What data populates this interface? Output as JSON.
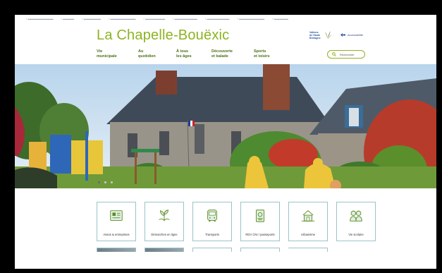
{
  "site": {
    "title": "La Chapelle-Bouëxic",
    "logo_text_lines": [
      "Vallons",
      "de Haute",
      "Bretagne"
    ],
    "accessibility_label": "Accessibilité"
  },
  "nav": {
    "items": [
      {
        "line1": "Vie",
        "line2": "municipale"
      },
      {
        "line1": "Au",
        "line2": "quotidien"
      },
      {
        "line1": "À tous",
        "line2": "les âges"
      },
      {
        "line1": "Découverte",
        "line2": "et balade"
      },
      {
        "line1": "Sports",
        "line2": "et loisirs"
      }
    ]
  },
  "search": {
    "label": "Rechercher"
  },
  "carousel": {
    "slide_count": 3,
    "active_index": 0
  },
  "quick_links": [
    {
      "label": "Assos & entreprises",
      "icon": "building-card-icon"
    },
    {
      "label": "Démarches en ligne",
      "icon": "hand-plant-icon"
    },
    {
      "label": "Transports",
      "icon": "bus-icon"
    },
    {
      "label": "RDV CNI / passeports",
      "icon": "id-document-icon"
    },
    {
      "label": "Urbanisme",
      "icon": "house-plan-icon"
    },
    {
      "label": "Vie scolaire",
      "icon": "students-icon"
    }
  ],
  "colors": {
    "brand_green": "#8db321",
    "nav_green": "#4b6f16",
    "tile_border": "#9cc2c9",
    "icon_green": "#5e8a1f"
  }
}
